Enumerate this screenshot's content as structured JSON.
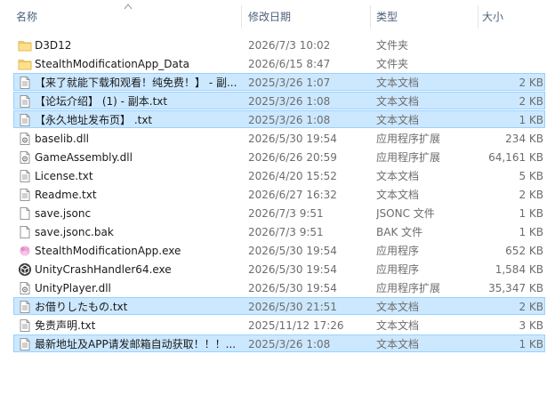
{
  "columns": {
    "name": "名称",
    "date": "修改日期",
    "type": "类型",
    "size": "大小"
  },
  "files": [
    {
      "name": "D3D12",
      "date": "2026/7/3 10:02",
      "type": "文件夹",
      "size": "",
      "icon": "folder-icon",
      "selected": false
    },
    {
      "name": "StealthModificationApp_Data",
      "date": "2026/6/15 8:47",
      "type": "文件夹",
      "size": "",
      "icon": "folder-icon",
      "selected": false
    },
    {
      "name": "【来了就能下载和观看！纯免费！】 - 副...",
      "date": "2025/3/26 1:07",
      "type": "文本文档",
      "size": "2 KB",
      "icon": "text-file-icon",
      "selected": true
    },
    {
      "name": "【论坛介绍】 (1) - 副本.txt",
      "date": "2025/3/26 1:08",
      "type": "文本文档",
      "size": "2 KB",
      "icon": "text-file-icon",
      "selected": true
    },
    {
      "name": "【永久地址发布页】 .txt",
      "date": "2025/3/26 1:08",
      "type": "文本文档",
      "size": "1 KB",
      "icon": "text-file-icon",
      "selected": true
    },
    {
      "name": "baselib.dll",
      "date": "2026/5/30 19:54",
      "type": "应用程序扩展",
      "size": "234 KB",
      "icon": "dll-file-icon",
      "selected": false
    },
    {
      "name": "GameAssembly.dll",
      "date": "2026/6/26 20:59",
      "type": "应用程序扩展",
      "size": "64,161 KB",
      "icon": "dll-file-icon",
      "selected": false
    },
    {
      "name": "License.txt",
      "date": "2026/4/20 15:52",
      "type": "文本文档",
      "size": "5 KB",
      "icon": "text-file-icon",
      "selected": false
    },
    {
      "name": "Readme.txt",
      "date": "2026/6/27 16:32",
      "type": "文本文档",
      "size": "2 KB",
      "icon": "text-file-icon",
      "selected": false
    },
    {
      "name": "save.jsonc",
      "date": "2026/7/3 9:51",
      "type": "JSONC 文件",
      "size": "1 KB",
      "icon": "blank-file-icon",
      "selected": false
    },
    {
      "name": "save.jsonc.bak",
      "date": "2026/7/3 9:51",
      "type": "BAK 文件",
      "size": "1 KB",
      "icon": "blank-file-icon",
      "selected": false
    },
    {
      "name": "StealthModificationApp.exe",
      "date": "2026/5/30 19:54",
      "type": "应用程序",
      "size": "652 KB",
      "icon": "app-exe-icon",
      "selected": false
    },
    {
      "name": "UnityCrashHandler64.exe",
      "date": "2026/5/30 19:54",
      "type": "应用程序",
      "size": "1,584 KB",
      "icon": "unity-icon",
      "selected": false
    },
    {
      "name": "UnityPlayer.dll",
      "date": "2026/5/30 19:54",
      "type": "应用程序扩展",
      "size": "35,347 KB",
      "icon": "dll-file-icon",
      "selected": false
    },
    {
      "name": "お借りしたもの.txt",
      "date": "2026/5/30 21:51",
      "type": "文本文档",
      "size": "2 KB",
      "icon": "text-file-icon",
      "selected": true
    },
    {
      "name": "免责声明.txt",
      "date": "2025/11/12 17:26",
      "type": "文本文档",
      "size": "3 KB",
      "icon": "text-file-icon",
      "selected": false
    },
    {
      "name": "最新地址及APP请发邮箱自动获取！！！...",
      "date": "2025/3/26 1:08",
      "type": "文本文档",
      "size": "1 KB",
      "icon": "text-file-icon",
      "selected": true
    }
  ],
  "colors": {
    "selection_bg": "#cce8ff",
    "selection_border": "#99d1ff",
    "header_text": "#4c607a",
    "folder": "#f8d775"
  }
}
